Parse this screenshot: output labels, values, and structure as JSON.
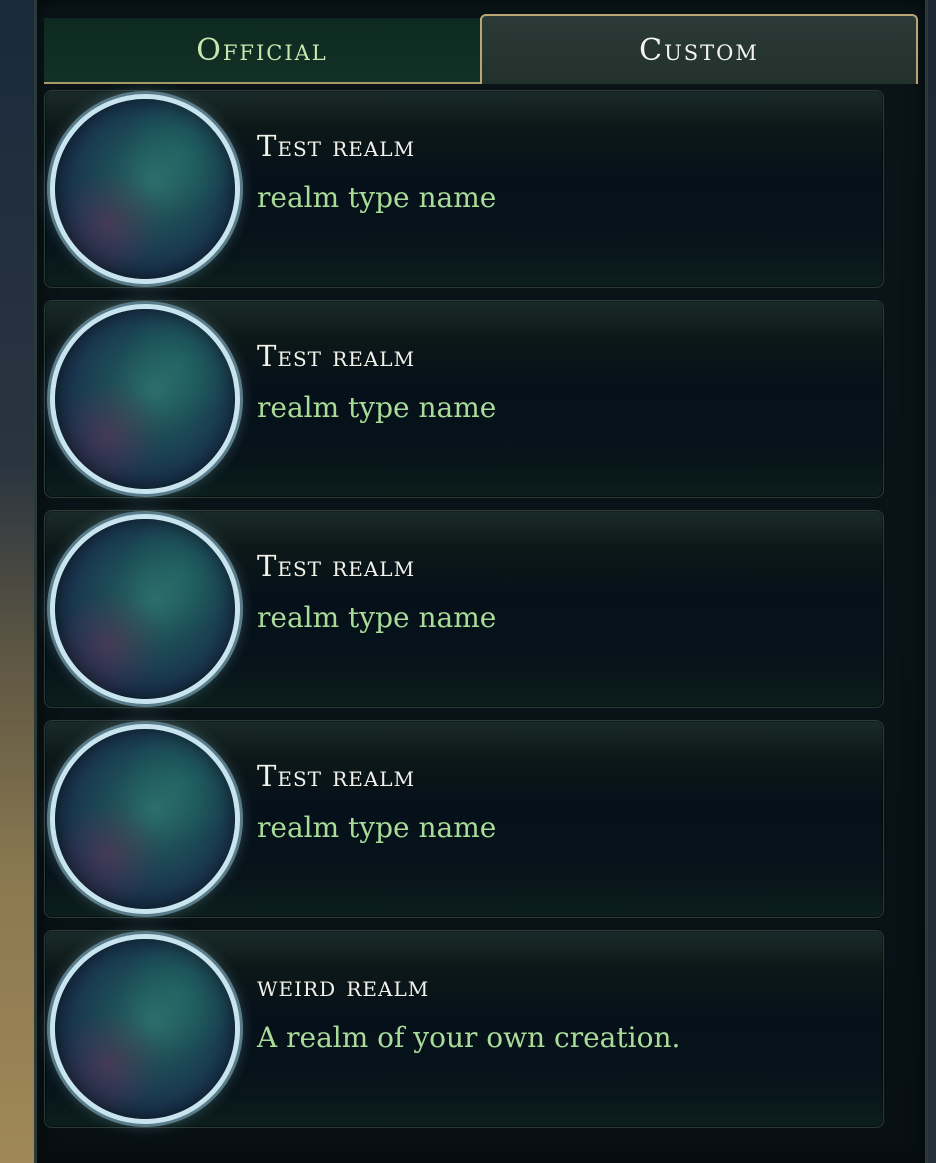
{
  "tabs": {
    "official_label": "Official",
    "custom_label": "Custom"
  },
  "realms": [
    {
      "name": "Test realm",
      "type": "realm type name"
    },
    {
      "name": "Test realm",
      "type": "realm type name"
    },
    {
      "name": "Test realm",
      "type": "realm type name"
    },
    {
      "name": "Test realm",
      "type": "realm type name"
    },
    {
      "name": "weird realm",
      "type": "A realm of your own creation."
    }
  ]
}
